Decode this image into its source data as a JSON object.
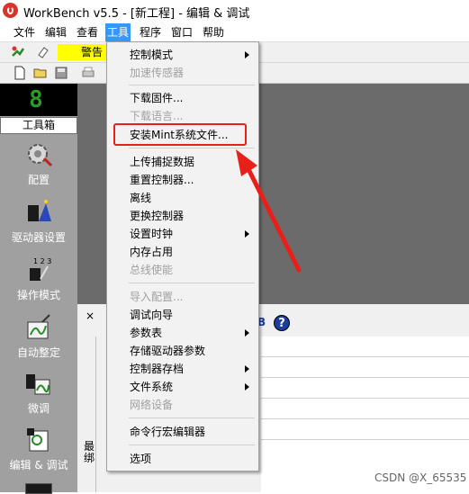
{
  "window": {
    "title": "WorkBench v5.5 - [新工程] - 编辑 & 调试"
  },
  "menubar": {
    "items": [
      {
        "label": "文件"
      },
      {
        "label": "编辑"
      },
      {
        "label": "查看"
      },
      {
        "label": "工具"
      },
      {
        "label": "程序"
      },
      {
        "label": "窗口"
      },
      {
        "label": "帮助"
      }
    ],
    "active": "工具"
  },
  "toolbar": {
    "warning_label": "警告"
  },
  "left_panel": {
    "status_digit": "8",
    "toolbox_title": "工具箱",
    "tools": [
      {
        "label": "配置",
        "icon": "gear-icon"
      },
      {
        "label": "驱动器设置",
        "icon": "drive-wizard-icon"
      },
      {
        "label": "操作模式",
        "icon": "operating-mode-icon"
      },
      {
        "label": "自动整定",
        "icon": "autotune-icon"
      },
      {
        "label": "微调",
        "icon": "finetune-icon"
      },
      {
        "label": "编辑 & 调试",
        "icon": "edit-debug-icon"
      }
    ]
  },
  "tools_menu": {
    "items": [
      {
        "label": "控制模式",
        "enabled": true,
        "submenu": true
      },
      {
        "label": "加速传感器",
        "enabled": false,
        "submenu": false
      },
      {
        "label": "下载固件...",
        "enabled": true,
        "submenu": false
      },
      {
        "label": "下载语言...",
        "enabled": false,
        "submenu": false
      },
      {
        "label": "安装Mint系统文件...",
        "enabled": true,
        "submenu": false
      },
      {
        "label": "上传捕捉数据",
        "enabled": true,
        "submenu": false
      },
      {
        "label": "重置控制器...",
        "enabled": true,
        "submenu": false
      },
      {
        "label": "离线",
        "enabled": true,
        "submenu": false
      },
      {
        "label": "更换控制器",
        "enabled": true,
        "submenu": false
      },
      {
        "label": "设置时钟",
        "enabled": true,
        "submenu": true
      },
      {
        "label": "内存占用",
        "enabled": true,
        "submenu": false
      },
      {
        "label": "总线使能",
        "enabled": false,
        "submenu": false
      },
      {
        "label": "导入配置...",
        "enabled": false,
        "submenu": false
      },
      {
        "label": "调试向导",
        "enabled": true,
        "submenu": false
      },
      {
        "label": "参数表",
        "enabled": true,
        "submenu": true
      },
      {
        "label": "存储驱动器参数",
        "enabled": true,
        "submenu": false
      },
      {
        "label": "控制器存档",
        "enabled": true,
        "submenu": true
      },
      {
        "label": "文件系统",
        "enabled": true,
        "submenu": true
      },
      {
        "label": "网络设备",
        "enabled": false,
        "submenu": false
      },
      {
        "label": "命令行宏编辑器",
        "enabled": true,
        "submenu": false
      },
      {
        "label": "选项",
        "enabled": true,
        "submenu": false
      }
    ]
  },
  "lower_panel": {
    "close_glyph": "×",
    "b_glyph": "B",
    "help_glyph": "?",
    "side_text": "最绑"
  },
  "watermark": "CSDN @X_65535",
  "colors": {
    "menu_highlight": "#3399ff",
    "warning_bg": "#ffff00",
    "annotation_red": "#e8201a",
    "left_panel_bg": "#a0a0a0",
    "digit_green": "#2a9a2a"
  }
}
